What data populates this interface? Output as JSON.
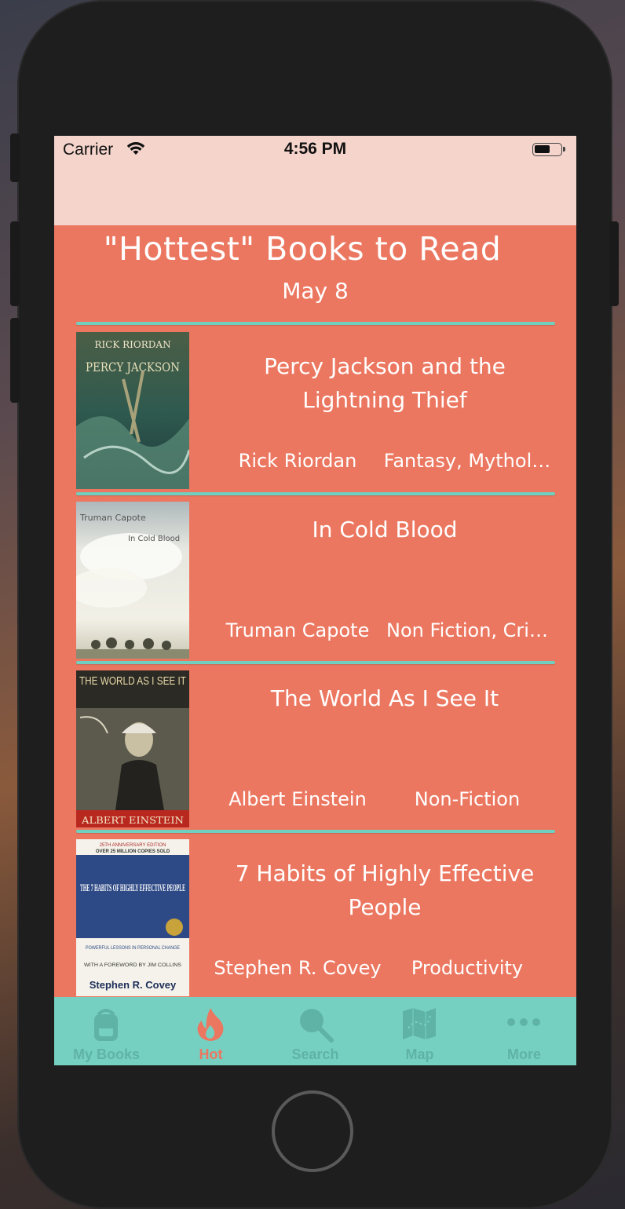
{
  "status_bar": {
    "carrier": "Carrier",
    "time": "4:56 PM",
    "battery_level": 0.6
  },
  "header": {
    "title": "\"Hottest\" Books to Read",
    "date": "May 8"
  },
  "books": [
    {
      "title": "Percy Jackson and the Lightning Thief",
      "author": "Rick Riordan",
      "genre": "Fantasy, Mythol…",
      "cover": {
        "top_text": "RICK RIORDAN",
        "main_text": "PERCY JACKSON",
        "bg": "#2f5a4f",
        "accent": "#7fb06a"
      }
    },
    {
      "title": "In Cold Blood",
      "author": "Truman Capote",
      "genre": "Non Fiction, Cri…",
      "cover": {
        "top_text": "Truman Capote",
        "main_text": "In Cold Blood",
        "bg": "#d9dcd2",
        "accent": "#8aa0a8"
      }
    },
    {
      "title": "The World As I See It",
      "author": "Albert Einstein",
      "genre": "Non-Fiction",
      "cover": {
        "top_text": "THE WORLD AS I SEE IT",
        "main_text": "ALBERT EINSTEIN",
        "bg": "#2b2a25",
        "accent": "#b9281f"
      }
    },
    {
      "title": "7 Habits of Highly Effective People",
      "author": "Stephen R. Covey",
      "genre": "Productivity",
      "cover": {
        "top_text": "25TH ANNIVERSARY EDITION",
        "sub_text": "OVER 25 MILLION COPIES SOLD",
        "main_text": "THE 7 HABITS OF HIGHLY EFFECTIVE PEOPLE",
        "lessons": "POWERFUL LESSONS IN PERSONAL CHANGE",
        "foreword": "WITH A FOREWORD BY JIM COLLINS",
        "author_text": "Stephen R. Covey",
        "bg": "#2e4a86",
        "accent": "#ffffff"
      }
    }
  ],
  "tabs": [
    {
      "label": "My Books",
      "icon": "backpack-icon",
      "active": false
    },
    {
      "label": "Hot",
      "icon": "flame-icon",
      "active": true
    },
    {
      "label": "Search",
      "icon": "search-icon",
      "active": false
    },
    {
      "label": "Map",
      "icon": "map-icon",
      "active": false
    },
    {
      "label": "More",
      "icon": "more-dots-icon",
      "active": false
    }
  ],
  "colors": {
    "primary": "#ec7760",
    "accent": "#76d0c2",
    "status_bg": "#f4d4cb",
    "tab_inactive": "#5fb3a6"
  }
}
